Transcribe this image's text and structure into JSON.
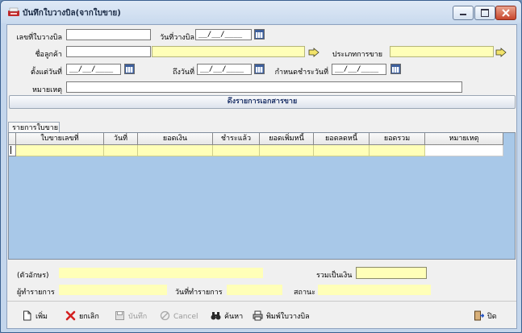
{
  "window": {
    "title": "บันทึกใบวางบิล(จากใบขาย)",
    "icon": "app-icon",
    "controls": [
      "minimize-icon",
      "maximize-icon",
      "close-icon"
    ]
  },
  "form": {
    "bill_no": {
      "label": "เลขที่ใบวางบิล",
      "value": ""
    },
    "bill_date": {
      "label": "วันที่วางบิล",
      "value": "__/__/____"
    },
    "customer": {
      "label": "ชื่อลูกค้า",
      "code": "",
      "name": ""
    },
    "sale_type": {
      "label": "ประเภทการขาย",
      "value": ""
    },
    "from_date": {
      "label": "ตั้งแต่วันที่",
      "value": "__/__/____"
    },
    "to_date": {
      "label": "ถึงวันที่",
      "value": "__/__/____"
    },
    "due_date": {
      "label": "กำหนดชำระวันที่",
      "value": "__/__/____"
    },
    "remark": {
      "label": "หมายเหตุ",
      "value": ""
    },
    "fetch_button": "ดึงรายการเอกสารขาย"
  },
  "tab": {
    "label": "รายการใบขาย"
  },
  "grid": {
    "columns": [
      "ใบขายเลขที่",
      "วันที่",
      "ยอดเงิน",
      "ชำระแล้ว",
      "ยอดเพิ่มหนี้",
      "ยอดลดหนี้",
      "ยอดรวม",
      "หมายเหตุ"
    ],
    "rows": [
      [
        "",
        "",
        "",
        "",
        "",
        "",
        "",
        ""
      ]
    ]
  },
  "summary": {
    "amount_text_label": "(ตัวอักษร)",
    "amount_text": "",
    "total_label": "รวมเป็นเงิน",
    "total_value": "",
    "maker_label": "ผู้ทำรายการ",
    "maker_value": "",
    "made_date_label": "วันที่ทำรายการ",
    "made_date_value": "",
    "status_label": "สถานะ",
    "status_value": ""
  },
  "toolbar": {
    "add": "เพิ่ม",
    "cancel_doc": "ยกเลิก",
    "save": "บันทึก",
    "cancel": "Cancel",
    "search": "ค้นหา",
    "print": "พิมพ์ใบวางบิล",
    "exit": "ปิด"
  },
  "colors": {
    "required_field": "#ffffb8",
    "grid_background": "#a8c8e8",
    "delete_icon": "#d42020"
  }
}
